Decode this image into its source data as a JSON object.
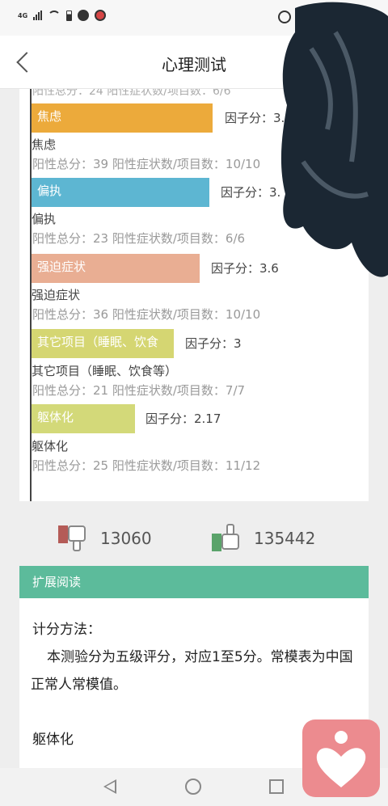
{
  "status_bar": {
    "network_label": "4G"
  },
  "header": {
    "title": "心理测试"
  },
  "results": {
    "cut_line": "阳性总分：24   阳性症状数/项目数：6/6",
    "items": [
      {
        "bar_label": "焦虑",
        "factor": "因子分：3.",
        "name": "焦虑",
        "stats": "阳性总分：39   阳性症状数/项目数：10/10",
        "color": "#ecaa3b"
      },
      {
        "bar_label": "偏执",
        "factor": "因子分：3.",
        "name": "偏执",
        "stats": "阳性总分：23   阳性症状数/项目数：6/6",
        "color": "#5db6d2"
      },
      {
        "bar_label": "强迫症状",
        "factor": "因子分：3.6",
        "name": "强迫症状",
        "stats": "阳性总分：36   阳性症状数/项目数：10/10",
        "color": "#e9ae93"
      },
      {
        "bar_label": "其它项目（睡眠、饮食",
        "factor": "因子分：3",
        "name": "其它项目（睡眠、饮食等）",
        "stats": "阳性总分：21   阳性症状数/项目数：7/7",
        "color": "#d5d672"
      },
      {
        "bar_label": "躯体化",
        "factor": "因子分：2.17",
        "name": "躯体化",
        "stats": "阳性总分：25   阳性症状数/项目数：11/12",
        "color": "#d3d979"
      }
    ]
  },
  "votes": {
    "dislike_count": "13060",
    "like_count": "135442"
  },
  "reading": {
    "header": "扩展阅读",
    "subtitle": "计分方法：",
    "body": "本测验分为五级评分，对应1至5分。常模表为中国正常人常模值。",
    "next_topic": "躯体化"
  },
  "colors": {
    "accent": "#5cbb9b",
    "float_button": "#ec8b8f"
  }
}
